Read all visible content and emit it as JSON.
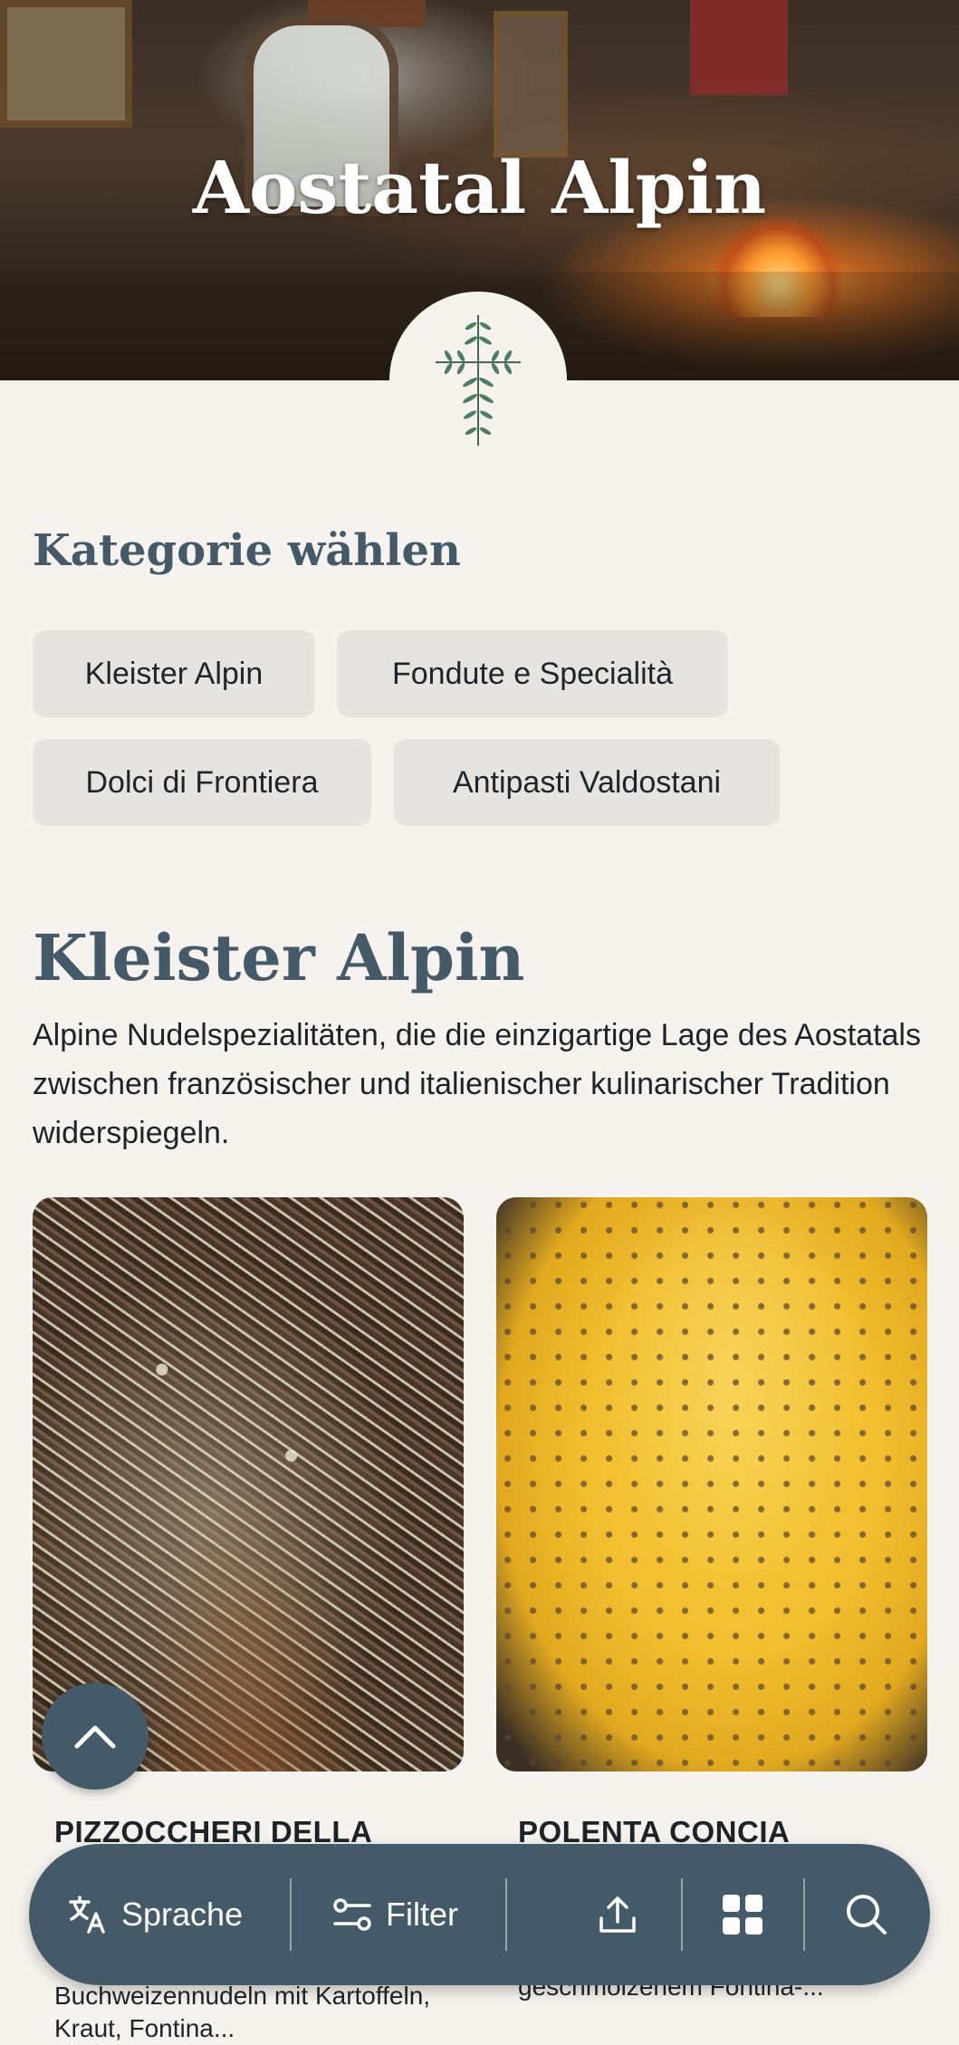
{
  "header": {
    "title": "Aostatal Alpin"
  },
  "categories": {
    "heading": "Kategorie wählen",
    "chips": [
      {
        "label": "Kleister Alpin"
      },
      {
        "label": "Fondute e Specialità"
      },
      {
        "label": "Dolci di Frontiera"
      },
      {
        "label": "Antipasti Valdostani"
      }
    ]
  },
  "section": {
    "title": "Kleister Alpin",
    "description": "Alpine Nudelspezialitäten, die die einzigartige Lage des Aostatals zwischen französischer und italienischer kulinarischer Tradition widerspiegeln."
  },
  "dishes": [
    {
      "title": "PIZZOCCHERI DELLA",
      "description": "Buchweizennudeln mit Kartoffeln, Kraut, Fontina..."
    },
    {
      "title": "POLENTA CONCIA",
      "description": "geschmolzenem Fontina-..."
    }
  ],
  "toolbar": {
    "language_label": "Sprache",
    "filter_label": "Filter"
  },
  "icons": {
    "language": "translate-icon",
    "filter": "filter-sliders-icon",
    "share": "share-upload-icon",
    "grid": "grid-view-icon",
    "search": "search-icon",
    "up": "chevron-up-icon",
    "logo": "herb-cross-icon"
  },
  "colors": {
    "accent": "#445a69",
    "background": "#f6f3ee",
    "chip": "#e6e4e1"
  }
}
